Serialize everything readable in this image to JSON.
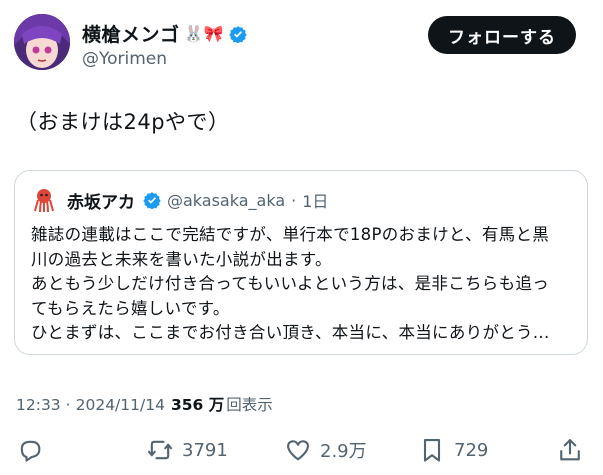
{
  "author": {
    "display_name": "横槍メンゴ",
    "name_emojis": "🐰🎀",
    "handle": "@Yorimen",
    "verified": true
  },
  "follow_button": {
    "label": "フォローする"
  },
  "post": {
    "text": "（おまけは24pやで）"
  },
  "quoted": {
    "display_name": "赤坂アカ",
    "handle": "@akasaka_aka",
    "separator": "·",
    "time": "1日",
    "verified": true,
    "lines": [
      "雑誌の連載はここで完結ですが、単行本で18Pのおまけと、有馬と黒",
      "川の過去と未来を書いた小説が出ます。",
      "あともう少しだけ付き合ってもいいよという方は、是非こちらも追っ",
      "てもらえたら嬉しいです。",
      "ひとまずは、ここまでお付き合い頂き、本当に、本当にありがとう..."
    ]
  },
  "meta": {
    "time": "12:33",
    "date": "2024/11/14",
    "separator": "·",
    "views_count": "356 万",
    "views_label": "回表示"
  },
  "actions": {
    "reposts": "3791",
    "likes": "2.9万",
    "bookmarks": "729"
  },
  "colors": {
    "text": "#0f1419",
    "secondary": "#536471",
    "verified": "#1d9bf0",
    "border": "#cfd9de"
  }
}
